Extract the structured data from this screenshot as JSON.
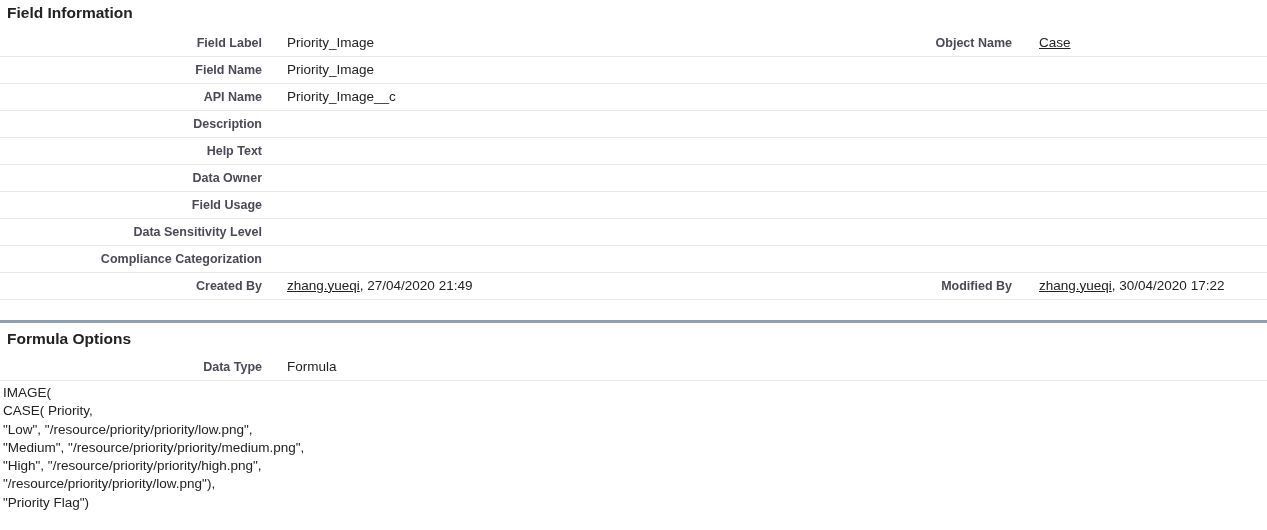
{
  "sections": [
    {
      "title": "Field Information",
      "rows": [
        {
          "label": "Field Label",
          "value": [
            {
              "kind": "text",
              "text": "Priority_Image"
            }
          ],
          "label2": "Object Name",
          "value2": [
            {
              "kind": "link",
              "text": "Case"
            }
          ]
        },
        {
          "label": "Field Name",
          "value": [
            {
              "kind": "text",
              "text": "Priority_Image"
            }
          ]
        },
        {
          "label": "API Name",
          "value": [
            {
              "kind": "text",
              "text": "Priority_Image__c"
            }
          ]
        },
        {
          "label": "Description"
        },
        {
          "label": "Help Text"
        },
        {
          "label": "Data Owner"
        },
        {
          "label": "Field Usage"
        },
        {
          "label": "Data Sensitivity Level"
        },
        {
          "label": "Compliance Categorization"
        },
        {
          "label": "Created By",
          "value": [
            {
              "kind": "link",
              "text": "zhang.yueqi"
            },
            {
              "kind": "text",
              "text": ", 27/04/2020 21:49"
            }
          ],
          "label2": "Modified By",
          "value2": [
            {
              "kind": "link",
              "text": "zhang.yueqi"
            },
            {
              "kind": "text",
              "text": ", 30/04/2020 17:22"
            }
          ]
        }
      ]
    },
    {
      "title": "Formula Options",
      "rows": [
        {
          "label": "Data Type",
          "value": [
            {
              "kind": "text",
              "text": "Formula"
            }
          ]
        }
      ],
      "formula": [
        "IMAGE(",
        "CASE( Priority,",
        "\"Low\", \"/resource/priority/priority/low.png\",",
        "\"Medium\", \"/resource/priority/priority/medium.png\",",
        "\"High\", \"/resource/priority/priority/high.png\",",
        "\"/resource/priority/priority/low.png\"),",
        "\"Priority Flag\")"
      ]
    }
  ]
}
